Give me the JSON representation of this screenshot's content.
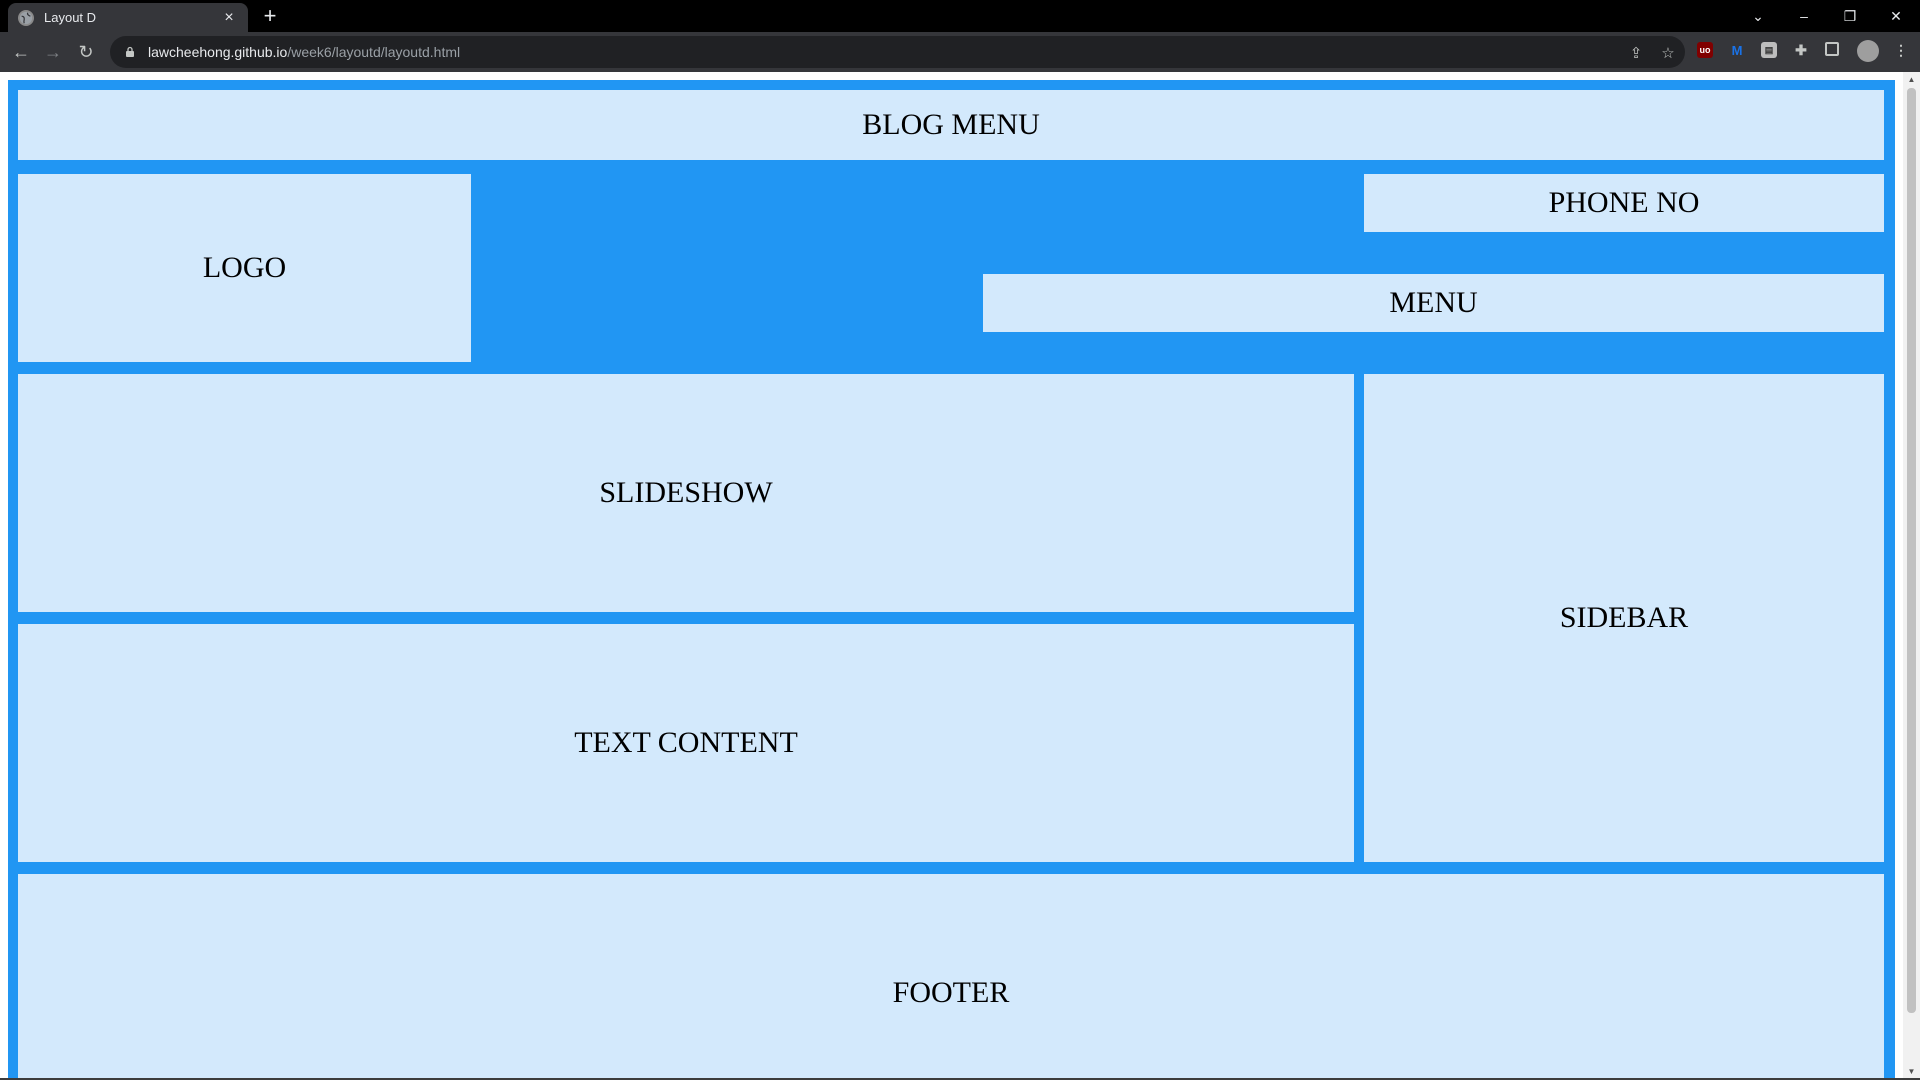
{
  "browser": {
    "tab_title": "Layout D",
    "tab_close": "×",
    "new_tab": "+",
    "url_host": "lawcheehong.github.io",
    "url_path": "/week6/layoutd/layoutd.html",
    "window_controls": {
      "tab_search": "⌄",
      "minimize": "–",
      "restore": "❐",
      "close": "✕"
    },
    "nav": {
      "back": "←",
      "forward": "→",
      "reload": "↻"
    },
    "extensions": [
      "uBlock",
      "M",
      "note",
      "puzzle",
      "sidepanel",
      "profile",
      "menu"
    ]
  },
  "layout": {
    "blog_menu": "BLOG MENU",
    "logo": "LOGO",
    "phone_no": "PHONE NO",
    "menu": "MENU",
    "slideshow": "SLIDESHOW",
    "text_content": "TEXT CONTENT",
    "sidebar": "SIDEBAR",
    "footer": "FOOTER"
  },
  "colors": {
    "background_blue": "#2196f3",
    "box_light_blue": "#d3e9fc"
  }
}
